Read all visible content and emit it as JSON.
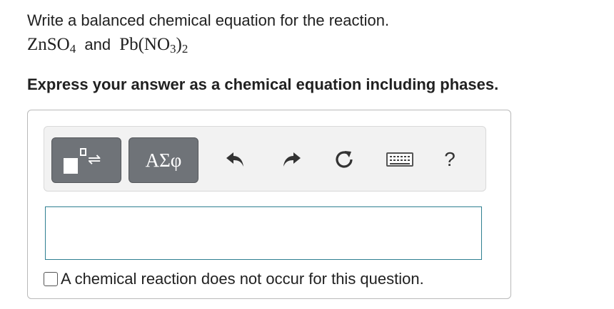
{
  "question": {
    "prompt": "Write a balanced chemical equation for the reaction.",
    "reactant1": {
      "formula": "ZnSO",
      "subscript": "4"
    },
    "connector": "and",
    "reactant2": {
      "prefix": "Pb(NO",
      "subscript1": "3",
      "mid": ")",
      "subscript2": "2"
    }
  },
  "instruction": "Express your answer as a chemical equation including phases.",
  "toolbar": {
    "templates_icon": "templates-reaction-icon",
    "greek_label": "ΑΣφ",
    "undo_icon": "undo-icon",
    "redo_icon": "redo-icon",
    "reset_icon": "reset-icon",
    "keyboard_icon": "keyboard-icon",
    "help_label": "?"
  },
  "answer_input": {
    "value": ""
  },
  "no_reaction": {
    "label": "A chemical reaction does not occur for this question.",
    "checked": false
  },
  "colors": {
    "button_bg": "#6f7378",
    "toolbar_bg": "#f2f2f2",
    "input_border": "#2f7f91",
    "box_border": "#b9b9b9"
  }
}
